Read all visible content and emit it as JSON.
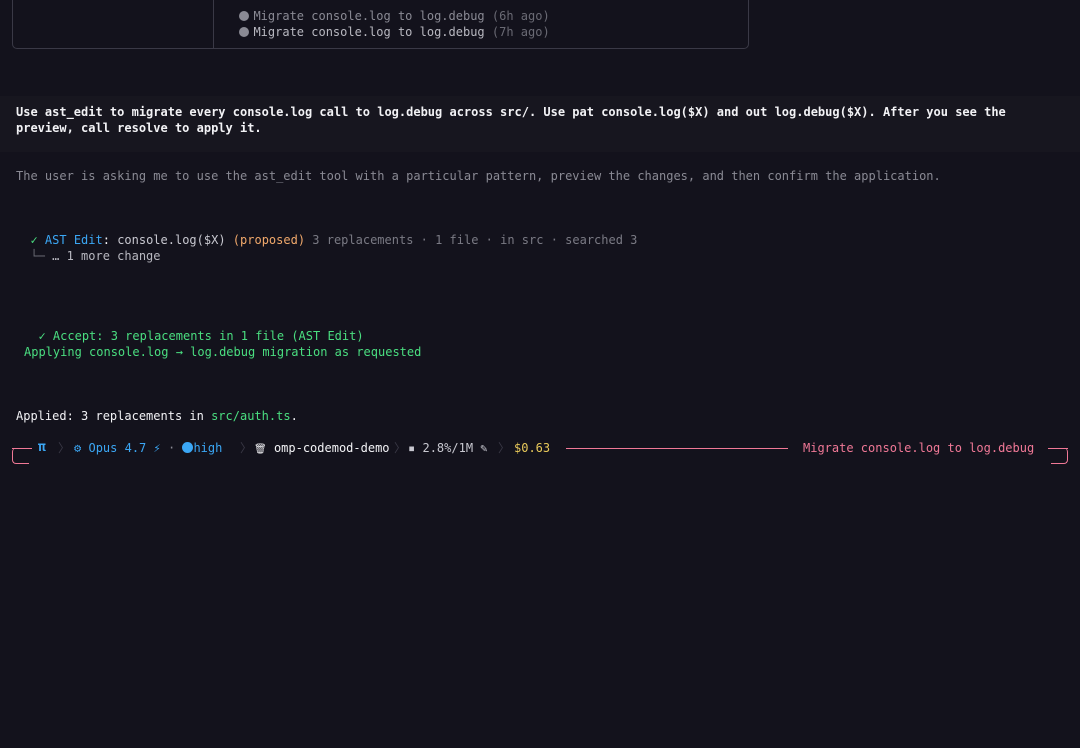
{
  "sessions": {
    "row1": "Migrate console.log to log.debug",
    "row1_age": "(6h ago)",
    "row2": "Migrate console.log to log.debug",
    "row2_age": "(7h ago)"
  },
  "user_prompt": {
    "line1": "Use ast_edit to migrate every console.log call to log.debug across src/. Use pat console.log($X) and out log.debug($X). After you see the",
    "line2": "preview, call resolve to apply it."
  },
  "thinking": "The user is asking me to use the ast_edit tool with a particular pattern, preview the changes, and then confirm the application.",
  "tool_call": {
    "check": "✓",
    "name": "AST Edit",
    "colon": ":",
    "pattern": "console.log($X)",
    "status": "(proposed)",
    "summary": "3 replacements · 1 file · in src · searched 3",
    "more_prefix": "└─",
    "more": "… 1 more change"
  },
  "accept": {
    "check": "✓",
    "text": "Accept: 3 replacements in 1 file (AST Edit)",
    "reason": "Applying console.log → log.debug migration as requested"
  },
  "result": {
    "prefix": "Applied: 3 replacements in ",
    "file": "src/auth.ts",
    "suffix": "."
  },
  "status_bar": {
    "pi": "π",
    "model_icon": "⚙",
    "model": "Opus 4.7",
    "bolt": "⚡",
    "sep": "·",
    "effort": "high",
    "folder_icon": "🗑",
    "project": "omp-codemod-demo",
    "context_icon": "▪",
    "context": "2.8%/1M",
    "wand_icon": "✎",
    "cost": "$0.63",
    "session_title": "Migrate console.log to log.debug"
  },
  "colors": {
    "background": "#13121c",
    "accent_blue": "#3ba7f5",
    "accent_green": "#4ade80",
    "accent_pink": "#f07896",
    "accent_orange": "#f0a86b",
    "accent_yellow": "#e8c95a"
  }
}
